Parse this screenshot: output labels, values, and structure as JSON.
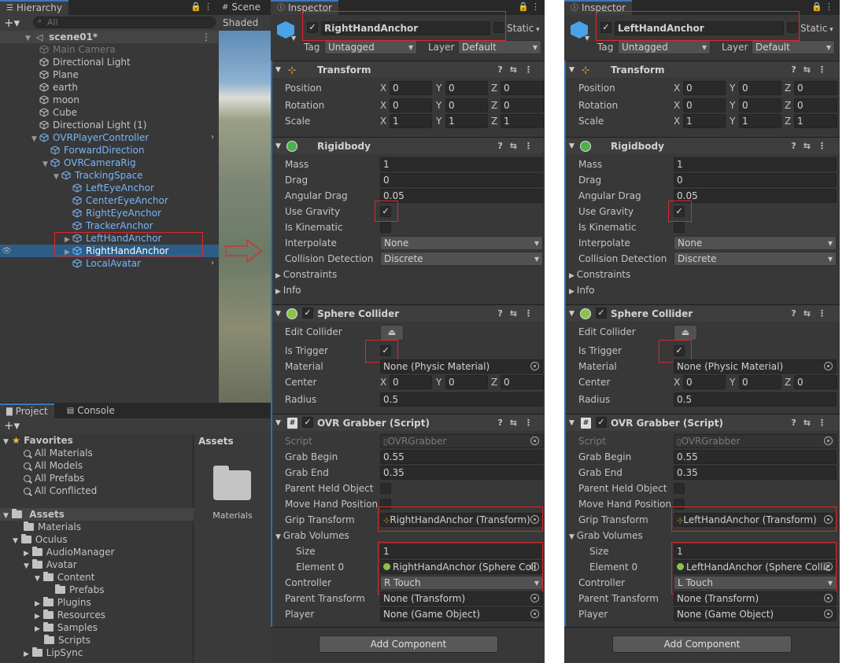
{
  "hierarchy": {
    "tab": "Hierarchy",
    "search_placeholder": "All",
    "scene": "scene01*",
    "items": [
      {
        "label": "Main Camera",
        "style": "grey"
      },
      {
        "label": "Directional Light",
        "style": "normal"
      },
      {
        "label": "Plane",
        "style": "normal"
      },
      {
        "label": "earth",
        "style": "normal"
      },
      {
        "label": "moon",
        "style": "normal"
      },
      {
        "label": "Cube",
        "style": "normal"
      },
      {
        "label": "Directional Light (1)",
        "style": "normal"
      },
      {
        "label": "OVRPlayerController",
        "style": "blue"
      },
      {
        "label": "ForwardDirection",
        "style": "blue"
      },
      {
        "label": "OVRCameraRig",
        "style": "blue"
      },
      {
        "label": "TrackingSpace",
        "style": "blue"
      },
      {
        "label": "LeftEyeAnchor",
        "style": "blue"
      },
      {
        "label": "CenterEyeAnchor",
        "style": "blue"
      },
      {
        "label": "RightEyeAnchor",
        "style": "blue"
      },
      {
        "label": "TrackerAnchor",
        "style": "blue"
      },
      {
        "label": "LeftHandAnchor",
        "style": "blue"
      },
      {
        "label": "RightHandAnchor",
        "style": "selected"
      },
      {
        "label": "LocalAvatar",
        "style": "blue"
      }
    ]
  },
  "scene": {
    "tab": "Scene",
    "shading": "Shaded"
  },
  "project": {
    "tabs": [
      "Project",
      "Console"
    ],
    "favorites_label": "Favorites",
    "favorites": [
      "All Materials",
      "All Models",
      "All Prefabs",
      "All Conflicted"
    ],
    "assets_label": "Assets",
    "tree": [
      "Materials",
      "Oculus",
      "AudioManager",
      "Avatar",
      "Content",
      "Prefabs",
      "Plugins",
      "Resources",
      "Samples",
      "Scripts",
      "LipSync"
    ],
    "breadcrumb": "Assets",
    "grid_item": "Materials"
  },
  "inspectors": [
    {
      "tab": "Inspector",
      "object_name": "RightHandAnchor",
      "static_label": "Static",
      "tag_label": "Tag",
      "tag": "Untagged",
      "layer_label": "Layer",
      "layer": "Default",
      "transform": {
        "title": "Transform",
        "position_label": "Position",
        "rotation_label": "Rotation",
        "scale_label": "Scale",
        "position": [
          "0",
          "0",
          "0"
        ],
        "rotation": [
          "0",
          "0",
          "0"
        ],
        "scale": [
          "1",
          "1",
          "1"
        ]
      },
      "rigidbody": {
        "title": "Rigidbody",
        "mass_label": "Mass",
        "mass": "1",
        "drag_label": "Drag",
        "drag": "0",
        "angular_drag_label": "Angular Drag",
        "angular_drag": "0.05",
        "use_gravity_label": "Use Gravity",
        "is_kinematic_label": "Is Kinematic",
        "interpolate_label": "Interpolate",
        "interpolate": "None",
        "collision_label": "Collision Detection",
        "collision": "Discrete",
        "constraints_label": "Constraints",
        "info_label": "Info"
      },
      "sphere": {
        "title": "Sphere Collider",
        "edit_label": "Edit Collider",
        "is_trigger_label": "Is Trigger",
        "material_label": "Material",
        "material": "None (Physic Material)",
        "center_label": "Center",
        "center": [
          "0",
          "0",
          "0"
        ],
        "radius_label": "Radius",
        "radius": "0.5"
      },
      "grabber": {
        "title": "OVR Grabber (Script)",
        "script_label": "Script",
        "script": "OVRGrabber",
        "grab_begin_label": "Grab Begin",
        "grab_begin": "0.55",
        "grab_end_label": "Grab End",
        "grab_end": "0.35",
        "parent_held_label": "Parent Held Object",
        "move_hand_label": "Move Hand Position",
        "grip_label": "Grip Transform",
        "grip": "RightHandAnchor (Transform)",
        "volumes_label": "Grab Volumes",
        "size_label": "Size",
        "size": "1",
        "element_label": "Element 0",
        "element": "RightHandAnchor (Sphere Coll",
        "controller_label": "Controller",
        "controller": "R Touch",
        "parent_transform_label": "Parent Transform",
        "parent_transform": "None (Transform)",
        "player_label": "Player",
        "player": "None (Game Object)"
      },
      "add_component": "Add Component"
    },
    {
      "tab": "Inspector",
      "object_name": "LeftHandAnchor",
      "static_label": "Static",
      "tag_label": "Tag",
      "tag": "Untagged",
      "layer_label": "Layer",
      "layer": "Default",
      "transform": {
        "title": "Transform",
        "position_label": "Position",
        "rotation_label": "Rotation",
        "scale_label": "Scale",
        "position": [
          "0",
          "0",
          "0"
        ],
        "rotation": [
          "0",
          "0",
          "0"
        ],
        "scale": [
          "1",
          "1",
          "1"
        ]
      },
      "rigidbody": {
        "title": "Rigidbody",
        "mass_label": "Mass",
        "mass": "1",
        "drag_label": "Drag",
        "drag": "0",
        "angular_drag_label": "Angular Drag",
        "angular_drag": "0.05",
        "use_gravity_label": "Use Gravity",
        "is_kinematic_label": "Is Kinematic",
        "interpolate_label": "Interpolate",
        "interpolate": "None",
        "collision_label": "Collision Detection",
        "collision": "Discrete",
        "constraints_label": "Constraints",
        "info_label": "Info"
      },
      "sphere": {
        "title": "Sphere Collider",
        "edit_label": "Edit Collider",
        "is_trigger_label": "Is Trigger",
        "material_label": "Material",
        "material": "None (Physic Material)",
        "center_label": "Center",
        "center": [
          "0",
          "0",
          "0"
        ],
        "radius_label": "Radius",
        "radius": "0.5"
      },
      "grabber": {
        "title": "OVR Grabber (Script)",
        "script_label": "Script",
        "script": "OVRGrabber",
        "grab_begin_label": "Grab Begin",
        "grab_begin": "0.55",
        "grab_end_label": "Grab End",
        "grab_end": "0.35",
        "parent_held_label": "Parent Held Object",
        "move_hand_label": "Move Hand Position",
        "grip_label": "Grip Transform",
        "grip": "LeftHandAnchor (Transform)",
        "volumes_label": "Grab Volumes",
        "size_label": "Size",
        "size": "1",
        "element_label": "Element 0",
        "element": "LeftHandAnchor (Sphere Collic",
        "controller_label": "Controller",
        "controller": "L Touch",
        "parent_transform_label": "Parent Transform",
        "parent_transform": "None (Transform)",
        "player_label": "Player",
        "player": "None (Game Object)"
      },
      "add_component": "Add Component"
    }
  ],
  "colors": {
    "highlight": "#e0262a",
    "selection": "#2c5d87",
    "prefab_blue": "#7ab5f6",
    "panel": "#383838"
  }
}
